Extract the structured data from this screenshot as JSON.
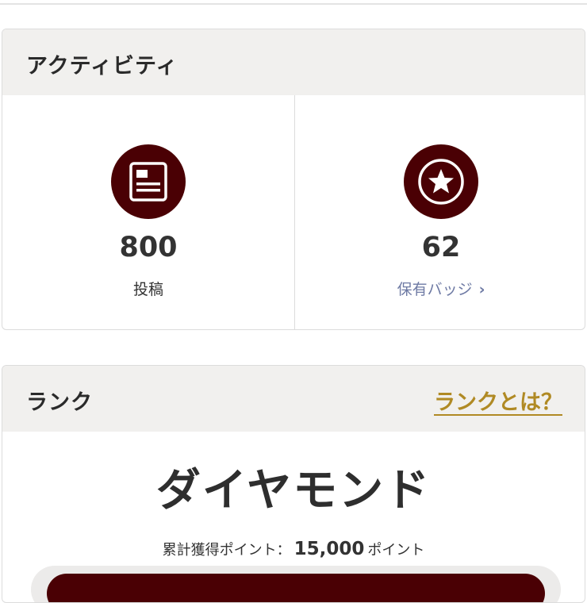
{
  "activity": {
    "title": "アクティビティ",
    "posts": {
      "value": "800",
      "label": "投稿",
      "icon": "article-icon"
    },
    "badges": {
      "value": "62",
      "label": "保有バッジ",
      "icon": "star-badge-icon",
      "chevron": "chevron-right-icon"
    }
  },
  "rank": {
    "title": "ランク",
    "help_link": "ランクとは？",
    "name": "ダイヤモンド",
    "points_label": "累計獲得ポイント：",
    "points_value": "15,000",
    "points_unit": "ポイント"
  },
  "colors": {
    "accent": "#4a0004",
    "link": "#6e7aa4",
    "gold_link": "#b08a24",
    "header_bg": "#f1f0ee"
  }
}
